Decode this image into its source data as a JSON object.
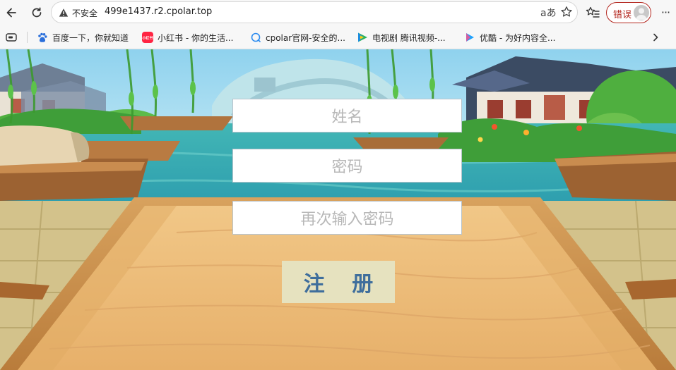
{
  "browser": {
    "security_label": "不安全",
    "url": "499e1437.r2.cpolar.top",
    "read_aloud_icon": "aあ",
    "error_button_label": "错误",
    "more_icon": "···"
  },
  "bookmarks": [
    {
      "label": "百度一下，你就知道",
      "icon": "baidu-paw-icon",
      "color": "#2a6fdb"
    },
    {
      "label": "小红书 - 你的生活...",
      "icon": "xiaohongshu-icon",
      "color": "#ff2442"
    },
    {
      "label": "cpolar官网-安全的...",
      "icon": "cpolar-icon",
      "color": "#2d8cf0"
    },
    {
      "label": "电视剧 腾讯视频-...",
      "icon": "tencent-video-icon",
      "color": "#27b35a"
    },
    {
      "label": "优酷 - 为好内容全...",
      "icon": "youku-icon",
      "color": "#1aa3ff"
    }
  ],
  "form": {
    "name_placeholder": "姓名",
    "password_placeholder": "密码",
    "confirm_password_placeholder": "再次输入密码",
    "submit_label": "注 册"
  }
}
